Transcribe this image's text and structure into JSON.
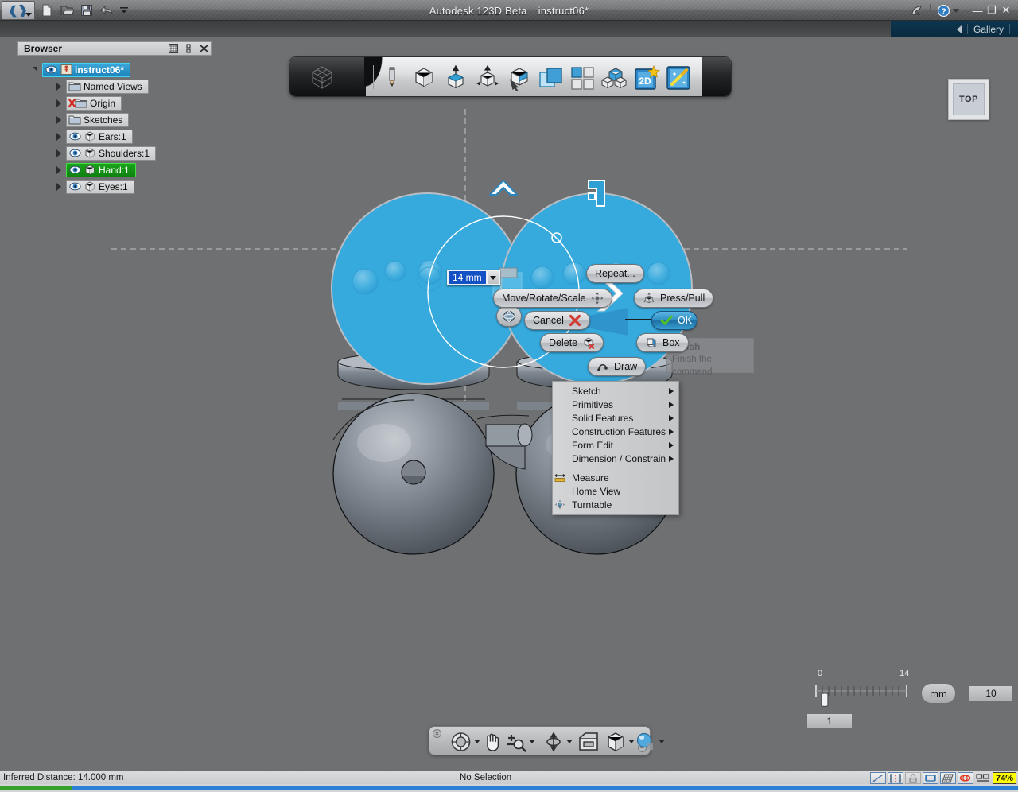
{
  "app": {
    "title": "Autodesk 123D Beta",
    "document": "instruct06*",
    "logo_icon": "autodesk-123d-logo",
    "quick_access": [
      {
        "name": "new-file-button",
        "icon": "new-document-icon"
      },
      {
        "name": "open-file-button",
        "icon": "open-folder-icon"
      },
      {
        "name": "save-button",
        "icon": "floppy-save-icon"
      },
      {
        "name": "undo-button",
        "icon": "undo-arrow-icon"
      },
      {
        "name": "qat-overflow-button",
        "icon": "chevron-down-icon"
      }
    ],
    "titlebar_right": [
      {
        "name": "share-button",
        "icon": "satellite-dish-icon"
      },
      {
        "name": "help-button",
        "icon": "question-circle-icon"
      }
    ],
    "window_controls": {
      "minimize": "—",
      "restore": "❐",
      "close": "✕"
    }
  },
  "gallery_bar": {
    "collapse_icon": "left-triangle-icon",
    "label": "Gallery"
  },
  "browser": {
    "header": {
      "title": "Browser",
      "buttons": [
        {
          "name": "browser-filter-button",
          "icon": "grid-list-icon"
        },
        {
          "name": "browser-dock-button",
          "icon": "dock-icon"
        },
        {
          "name": "browser-close-button",
          "icon": "close-x-icon"
        }
      ]
    },
    "tree": [
      {
        "label": "instruct06*",
        "icon": "pin-document-icon",
        "eye": true,
        "state": "selected-blue",
        "level": 0,
        "twisty": "open"
      },
      {
        "label": "Named Views",
        "icon": "folder-icon",
        "eye": false,
        "state": "normal",
        "level": 1,
        "twisty": "closed"
      },
      {
        "label": "Origin",
        "icon": "folder-hidden-icon",
        "eye": false,
        "state": "normal",
        "level": 1,
        "twisty": "closed"
      },
      {
        "label": "Sketches",
        "icon": "folder-icon",
        "eye": false,
        "state": "normal",
        "level": 1,
        "twisty": "closed"
      },
      {
        "label": "Ears:1",
        "icon": "solid-body-icon",
        "eye": true,
        "state": "normal",
        "level": 1,
        "twisty": "closed"
      },
      {
        "label": "Shoulders:1",
        "icon": "solid-body-icon",
        "eye": true,
        "state": "normal",
        "level": 1,
        "twisty": "closed"
      },
      {
        "label": "Hand:1",
        "icon": "solid-body-icon",
        "eye": true,
        "state": "selected-green",
        "level": 1,
        "twisty": "closed"
      },
      {
        "label": "Eyes:1",
        "icon": "solid-body-icon",
        "eye": true,
        "state": "normal",
        "level": 1,
        "twisty": "closed"
      }
    ]
  },
  "ribbon": {
    "home_icon": "viewcube-home-icon",
    "tools": [
      {
        "name": "sketch-tool",
        "icon": "pencil-icon"
      },
      {
        "name": "primitives-tool",
        "icon": "cube-icon"
      },
      {
        "name": "press-pull-tool",
        "icon": "cube-extrude-icon"
      },
      {
        "name": "transform-tool",
        "icon": "cube-move-arrows-icon"
      },
      {
        "name": "modify-tool",
        "icon": "cube-pointer-icon"
      },
      {
        "name": "combine-tool",
        "icon": "overlapping-squares-icon"
      },
      {
        "name": "pattern-tool",
        "icon": "four-squares-icon"
      },
      {
        "name": "grouping-tool",
        "icon": "cube-array-icon"
      },
      {
        "name": "2d-sketch-tool",
        "icon": "2d-star-icon"
      },
      {
        "name": "smart-tool",
        "icon": "magic-wand-icon"
      }
    ]
  },
  "viewcube": {
    "label": "TOP"
  },
  "marking_menu": {
    "buttons": [
      {
        "name": "repeat-button",
        "label": "Repeat...",
        "icon": null,
        "style": "normal"
      },
      {
        "name": "move-rotate-scale-button",
        "label": "Move/Rotate/Scale",
        "icon": "move-gizmo-icon",
        "style": "normal"
      },
      {
        "name": "press-pull-button",
        "label": "Press/Pull",
        "icon": "press-pull-gizmo-icon",
        "style": "normal"
      },
      {
        "name": "cancel-button",
        "label": "Cancel",
        "icon": "red-x-icon",
        "style": "normal"
      },
      {
        "name": "ok-button",
        "label": "OK",
        "icon": "green-check-icon",
        "style": "primary"
      },
      {
        "name": "delete-button",
        "label": "Delete",
        "icon": "cube-delete-icon",
        "style": "normal"
      },
      {
        "name": "box-button",
        "label": "Box",
        "icon": "box-primitive-icon",
        "style": "normal"
      },
      {
        "name": "draw-button",
        "label": "Draw",
        "icon": "draw-curve-icon",
        "style": "normal"
      }
    ],
    "orbit_widget": {
      "name": "orbit-widget",
      "icon": "orbit-sphere-icon"
    }
  },
  "dimension_field": {
    "value": "14 mm",
    "dropdown_icon": "chevron-down-icon"
  },
  "tooltip": {
    "title": "Finish",
    "body": "Finish the command."
  },
  "context_menu": {
    "items": [
      {
        "label": "Sketch",
        "submenu": true,
        "icon": null
      },
      {
        "label": "Primitives",
        "submenu": true,
        "icon": null
      },
      {
        "label": "Solid Features",
        "submenu": true,
        "icon": null
      },
      {
        "label": "Construction Features",
        "submenu": true,
        "icon": null
      },
      {
        "label": "Form Edit",
        "submenu": true,
        "icon": null
      },
      {
        "label": "Dimension / Constrain",
        "submenu": true,
        "icon": null
      },
      {
        "separator": true
      },
      {
        "label": "Measure",
        "submenu": false,
        "icon": "measure-ruler-icon"
      },
      {
        "label": "Home View",
        "submenu": false,
        "icon": null
      },
      {
        "label": "Turntable",
        "submenu": false,
        "icon": "turntable-icon"
      }
    ]
  },
  "scale_widget": {
    "min_tick_label": "0",
    "max_tick_label": "14",
    "unit_label": "mm",
    "snap_value": "1",
    "grid_value": "10"
  },
  "nav_bar": {
    "close_icon": "close-small-icon",
    "minimize_icon": "minimize-small-icon",
    "items": [
      {
        "name": "steering-wheel-button",
        "icon": "steering-wheel-icon",
        "caret": true
      },
      {
        "name": "pan-button",
        "icon": "hand-pan-icon",
        "caret": false
      },
      {
        "name": "zoom-button",
        "icon": "zoom-magnifier-icon",
        "caret": true
      },
      {
        "name": "orbit-button",
        "icon": "orbit-arrows-icon",
        "caret": true
      },
      {
        "name": "look-at-button",
        "icon": "look-at-icon",
        "caret": false
      },
      {
        "name": "view-cube-button",
        "icon": "cube-view-icon",
        "caret": true
      },
      {
        "name": "material-button",
        "icon": "material-sphere-icon",
        "caret": true
      }
    ]
  },
  "status_bar": {
    "left_text": "Inferred Distance: 14.000 mm",
    "center_text": "No Selection",
    "indicators": [
      {
        "name": "snap-line-toggle",
        "icon": "diagonal-line-icon",
        "active": true
      },
      {
        "name": "constraints-toggle",
        "icon": "constraint-brackets-icon",
        "active": true
      },
      {
        "name": "lock-toggle",
        "icon": "padlock-icon",
        "active": false
      },
      {
        "name": "dimension-toggle",
        "icon": "dimension-icon",
        "active": true
      },
      {
        "name": "grid-toggle",
        "icon": "grid-plane-icon",
        "active": true
      },
      {
        "name": "loop-toggle",
        "icon": "orbit-loop-icon",
        "active": true
      },
      {
        "name": "layout-toggle",
        "icon": "split-view-icon",
        "active": false
      }
    ],
    "zoom_level": "74%"
  },
  "progress": {
    "green_pct": 7,
    "green_color": "#37a02a",
    "blue_color": "#2b7fd4"
  },
  "colors": {
    "sketch_fill": "#36a9dd",
    "accent_blue": "#1d83bb",
    "selected_green": "#0f8210",
    "canvas_bg": "#6f7072",
    "highlight_yellow": "#ffff00"
  }
}
